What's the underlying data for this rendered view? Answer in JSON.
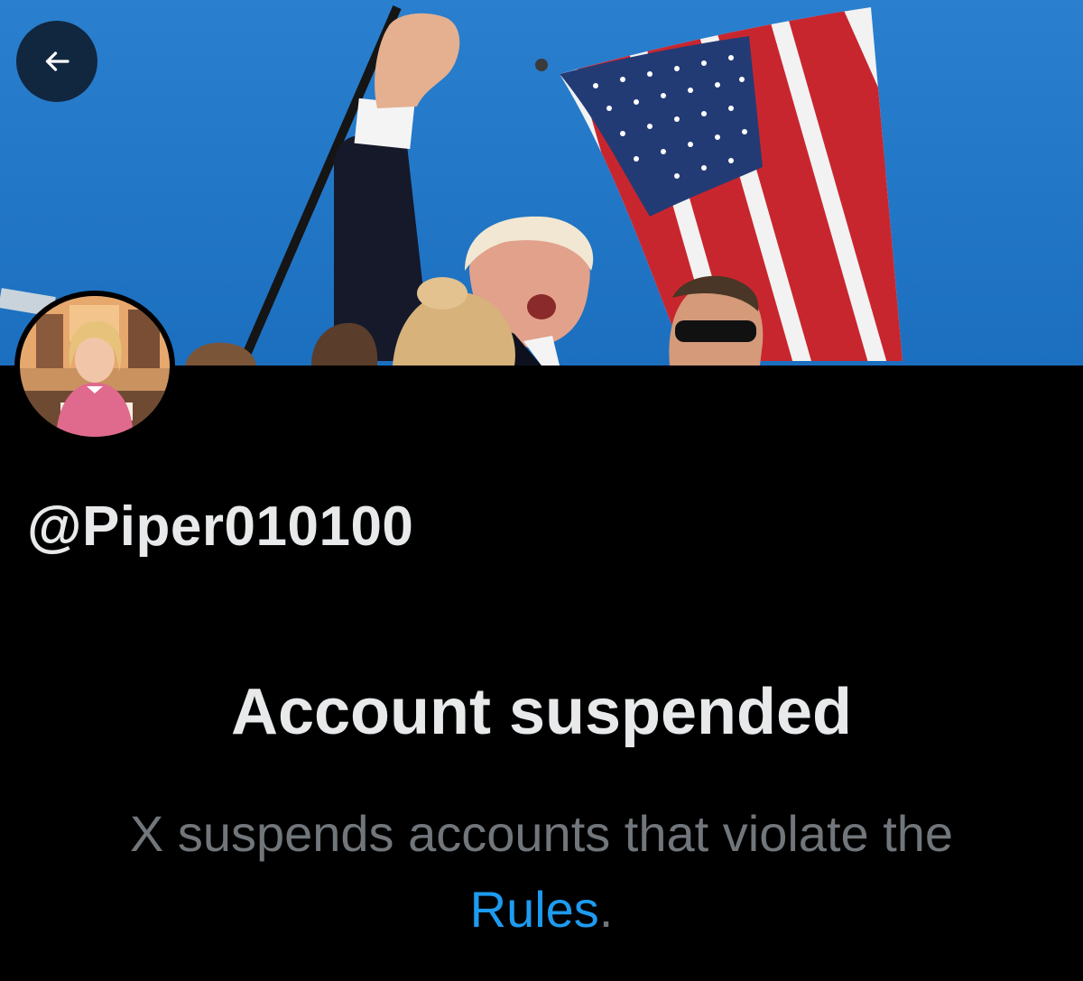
{
  "header": {
    "back_icon": "arrow-left-icon",
    "banner_image": "profile-header-photo",
    "colors": {
      "sky": "#1f78c8",
      "back_button_bg": "#0f2034"
    }
  },
  "profile": {
    "avatar": "profile-avatar-illustration",
    "handle": "@Piper010100"
  },
  "suspension": {
    "title": "Account suspended",
    "message_before": "X suspends accounts that violate the ",
    "rules_link": "Rules",
    "message_after": "."
  },
  "colors": {
    "background": "#000000",
    "primary_text": "#e7e9ea",
    "secondary_text": "#71767b",
    "link": "#1d9bf0"
  }
}
